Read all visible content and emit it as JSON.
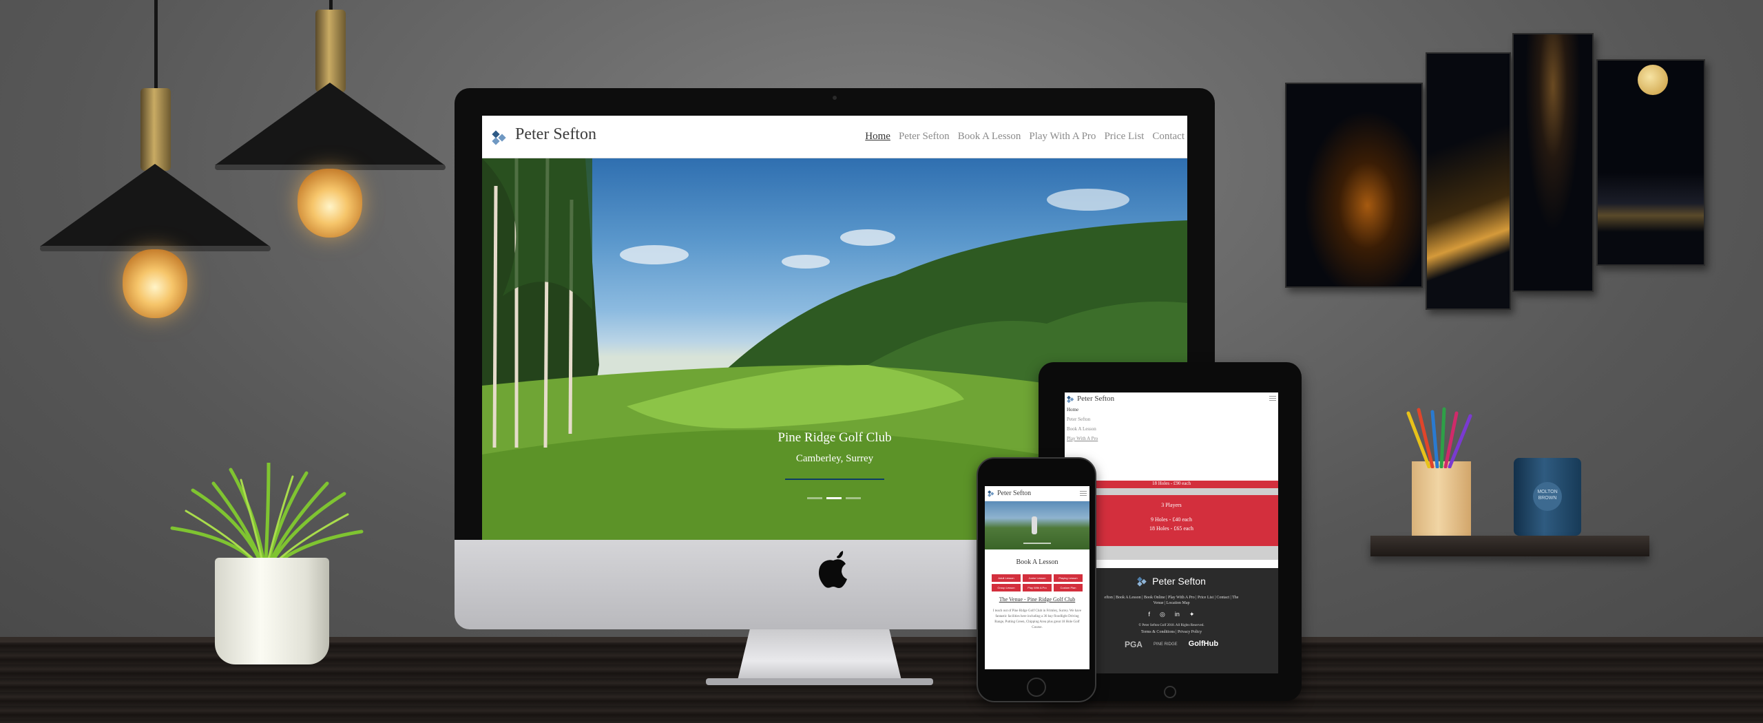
{
  "scene": {
    "description_colors": {
      "wall": "#6c6c6c",
      "desk": "#2a2421",
      "accent_red": "#d32f3d",
      "nav_blue": "#0d3c66"
    }
  },
  "imac_site": {
    "brand": "Peter Sefton",
    "nav": [
      "Home",
      "Peter Sefton",
      "Book A Lesson",
      "Play With A Pro",
      "Price List",
      "Contact"
    ],
    "active_nav": "Home",
    "hero": {
      "title": "Pine Ridge Golf Club",
      "subtitle": "Camberley, Surrey",
      "slides": 3,
      "active_slide": 2
    },
    "logo_icon": "diamond-logo-icon"
  },
  "ipad_site": {
    "brand": "Peter Sefton",
    "menu": [
      "Home",
      "Peter Sefton",
      "Book A Lesson",
      "Play With A Pro"
    ],
    "price_top": "18 Holes - £90 each",
    "players": "3 Players",
    "price_9": "9 Holes - £40 each",
    "price_18": "18 Holes - £65 each",
    "footer": {
      "brand": "Peter Sefton",
      "links_line1": "efton | Book A Lesson | Book Online | Play With A Pro | Price List | Contact | The",
      "links_line2": "Venue | Location Map",
      "social_icons": [
        "facebook-icon",
        "instagram-icon",
        "linkedin-icon",
        "twitter-icon"
      ],
      "copyright": "© Peter Sefton Golf 2018. All Rights Reserved.",
      "legal": "Terms & Conditions | Privacy Policy",
      "partners": [
        "PGA",
        "PINE RIDGE",
        "GolfHub"
      ]
    }
  },
  "phone_site": {
    "brand": "Peter Sefton",
    "heading": "Book A Lesson",
    "buttons": [
      "Adult Lesson",
      "Junior Lesson",
      "Playing Lesson",
      "Group Lesson",
      "Play With A Pro",
      "Custom Plan"
    ],
    "venue_link": "The Venue - Pine Ridge Golf Club",
    "body": "I teach out of Pine Ridge Golf Club in Frimley, Surrey. We have fantastic facilities here including a 36 bay floodlight Driving Range, Putting Green, Chipping Area plus great 18 Hole Golf Course."
  },
  "props": {
    "candle_label": "MOLTON BROWN"
  }
}
